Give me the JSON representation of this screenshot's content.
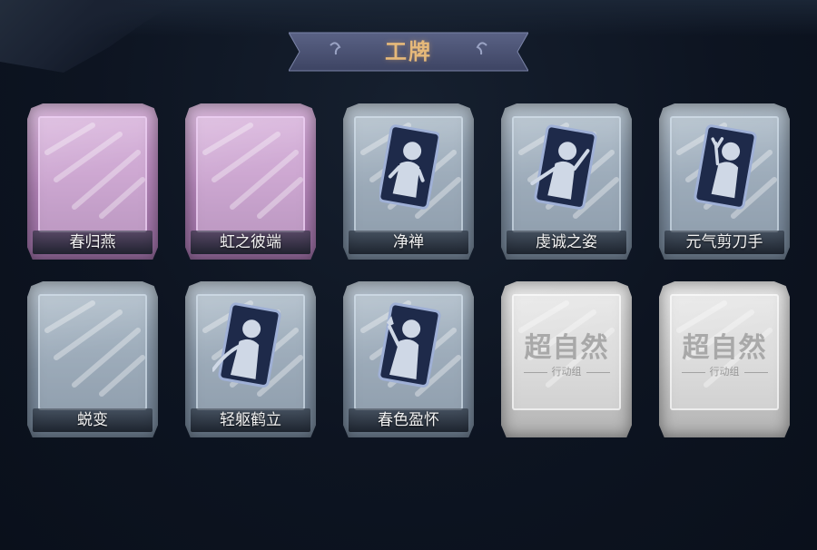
{
  "header": {
    "title": "工牌"
  },
  "colors": {
    "banner_text": "#e6b97a",
    "banner_bg": "#4a5170",
    "card_blue": "#8797a8",
    "card_pink": "#b889bd",
    "card_silver": "#cfcfcf"
  },
  "cards": [
    {
      "label": "春归燕",
      "style": "pink",
      "emblem": "none"
    },
    {
      "label": "虹之彼端",
      "style": "pink",
      "emblem": "none"
    },
    {
      "label": "净禅",
      "style": "blue",
      "emblem": "figure-card-icon"
    },
    {
      "label": "虔诚之姿",
      "style": "blue",
      "emblem": "figure-card-icon"
    },
    {
      "label": "元气剪刀手",
      "style": "blue",
      "emblem": "figure-card-icon"
    },
    {
      "label": "蜕变",
      "style": "blue",
      "emblem": "none"
    },
    {
      "label": "轻躯鹤立",
      "style": "blue",
      "emblem": "figure-card-icon"
    },
    {
      "label": "春色盈怀",
      "style": "blue",
      "emblem": "figure-card-icon"
    },
    {
      "label": "",
      "style": "silver",
      "emblem": "logo"
    },
    {
      "label": "",
      "style": "silver",
      "emblem": "logo"
    }
  ],
  "logo": {
    "main": "超自然",
    "sub": "行动组"
  }
}
